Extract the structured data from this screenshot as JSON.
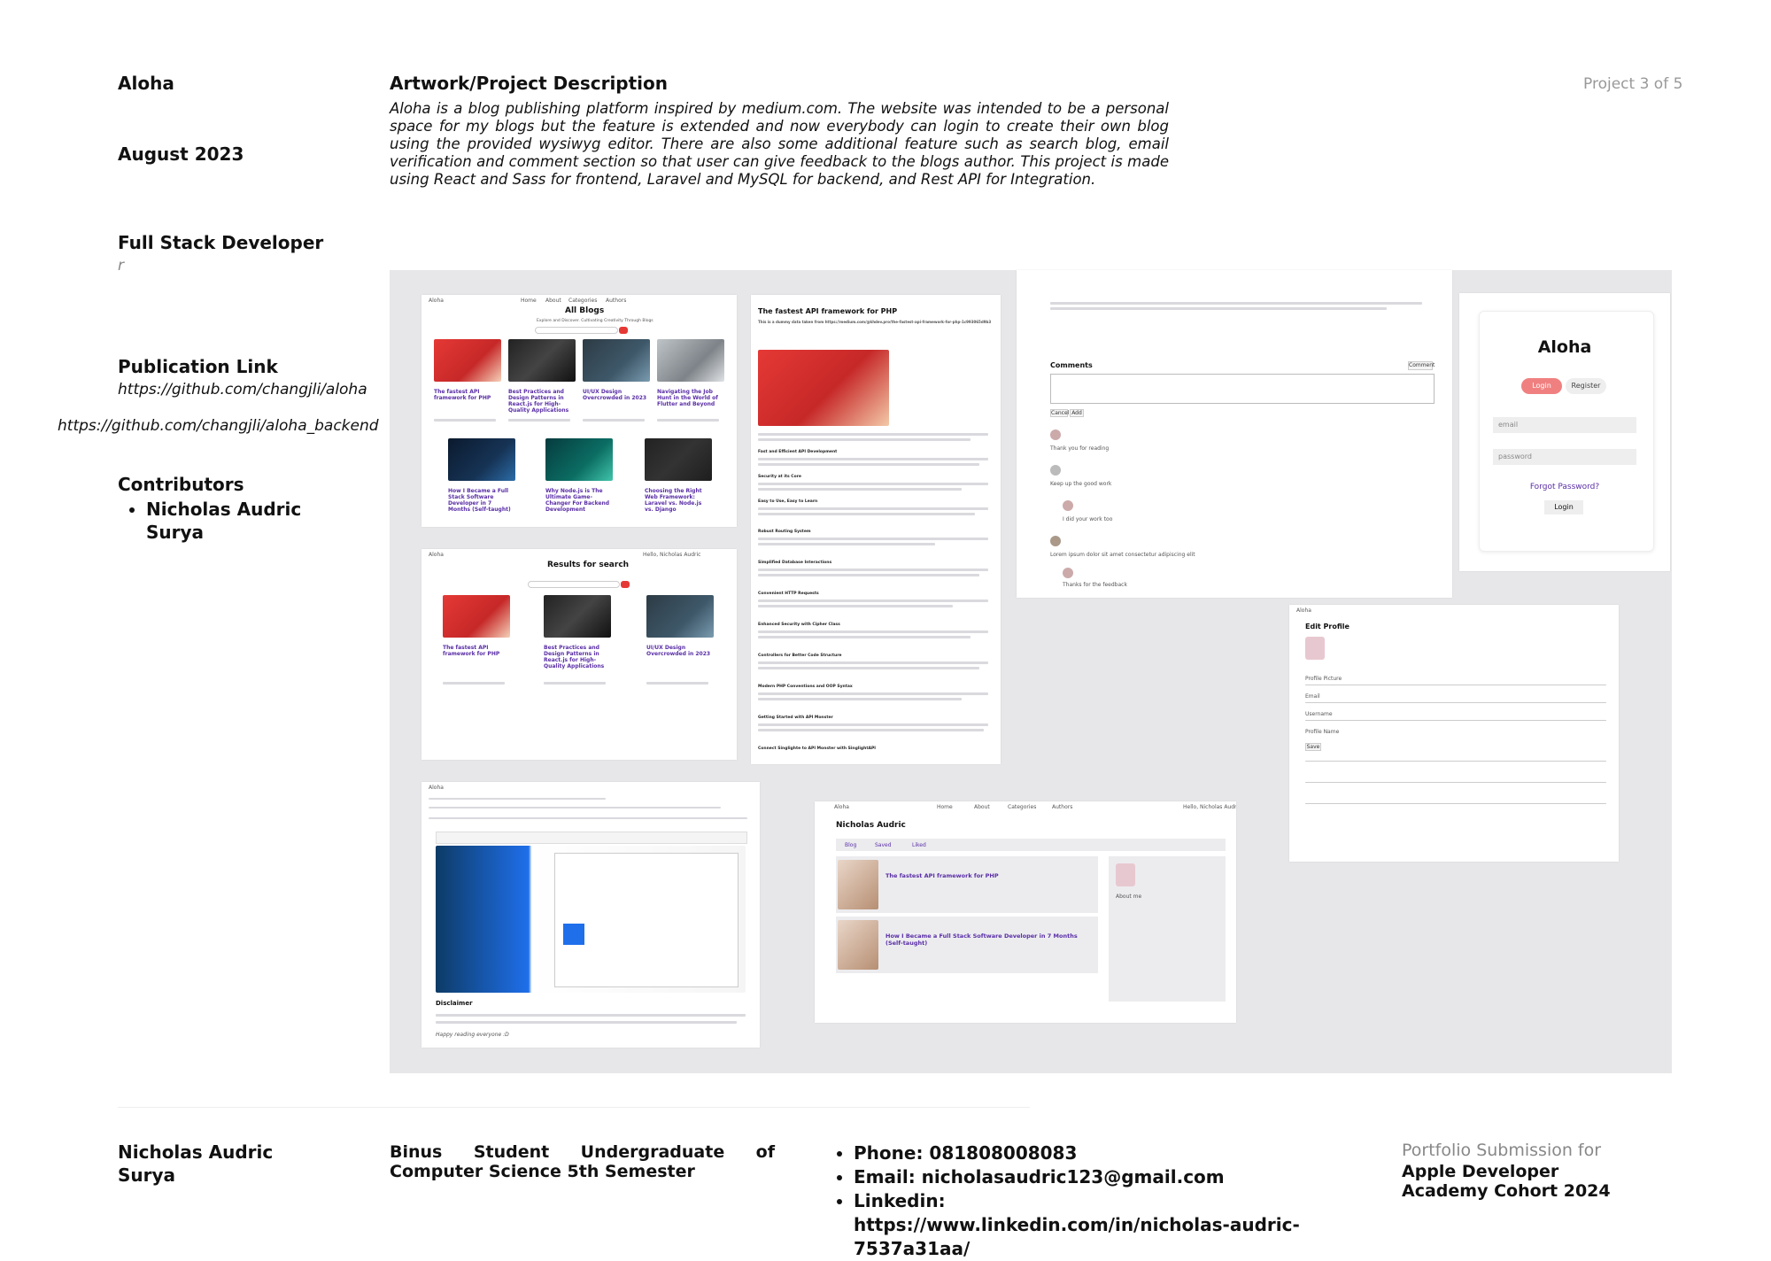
{
  "left": {
    "project_title": "Aloha",
    "date": "August 2023",
    "role": "Full Stack Developer",
    "role_sub": "r",
    "publication_heading": "Publication Link",
    "publication_links": [
      "https://github.com/changjli/aloha",
      "https://github.com/changjli/aloha_backend"
    ],
    "contributors_heading": "Contributors",
    "contributors": [
      "Nicholas Audric Surya"
    ]
  },
  "description": {
    "heading": "Artwork/Project Description",
    "text": "Aloha is a blog publishing platform inspired by medium.com. The website was intended to be a personal space for my blogs but the feature is extended and now everybody can login to create their own blog using the provided wysiwyg editor. There are also some additional feature such as search blog, email verification and comment section so that user can give feedback to the blogs author. This project is made using React and Sass for frontend, Laravel and MySQL for backend, and Rest API for Integration."
  },
  "project_counter": "Project 3 of 5",
  "screenshots": {
    "all_blogs": {
      "title": "All Blogs",
      "subtitle": "Explore and Discover. Cultivating Creativity Through Blogs",
      "cards": [
        "The fastest API framework for PHP",
        "Best Practices and Design Patterns in React.js for High-Quality Applications",
        "UI/UX Design Overcrowded in 2023",
        "Navigating the Job Hunt in the World of Flutter and Beyond",
        "How I Became a Full Stack Software Developer in 7 Months (Self-taught)",
        "Why Node.js is The Ultimate Game-Changer For Backend Development",
        "Choosing the Right Web Framework: Laravel vs. Node.js vs. Django"
      ]
    },
    "search": {
      "title": "Results for search",
      "cards": [
        "The fastest API framework for PHP",
        "Best Practices and Design Patterns in React.js for High-Quality Applications",
        "UI/UX Design Overcrowded in 2023"
      ]
    },
    "article": {
      "title": "The fastest API framework for PHP",
      "subtitle": "This is a dummy data taken from https://medium.com/@khdev.pro/the-fastest-api-framework-for-php-1c993065d9b3",
      "sections": [
        "Fast and Efficient API Development",
        "Security at its Core",
        "Easy to Use, Easy to Learn",
        "Robust Routing System",
        "Simplified Database Interactions",
        "Convenient HTTP Requests",
        "Enhanced Security with Cipher Class",
        "Controllers for Better Code Structure",
        "Modern PHP Conventions and OOP Syntax",
        "Getting Started with API Monster",
        "Connect Singlighte to API Monster with SinglightAPI"
      ]
    },
    "comments": {
      "heading": "Comments",
      "comment_button": "Comment",
      "cancel": "Cancel",
      "add": "Add",
      "entries": [
        "Thank you for reading",
        "Keep up the good work",
        "I did your work too",
        "Lorem ipsum dolor sit amet consectetur adipiscing elit",
        "Thanks for the feedback"
      ]
    },
    "login": {
      "brand": "Aloha",
      "tab_login": "Login",
      "tab_register": "Register",
      "email_placeholder": "email",
      "password_placeholder": "password",
      "forgot": "Forgot Password?",
      "submit": "Login"
    },
    "editor": {
      "disclaimer_heading": "Disclaimer",
      "closing": "Happy reading everyone :D"
    },
    "profile": {
      "name": "Nicholas Audric",
      "tabs": [
        "Blog",
        "Saved",
        "Liked"
      ],
      "posts": [
        "The fastest API framework for PHP",
        "How I Became a Full Stack Software Developer in 7 Months (Self-taught)"
      ],
      "about": "About me"
    },
    "edit_profile": {
      "title": "Edit Profile",
      "fields": [
        "Profile Picture",
        "Email",
        "Username",
        "Profile Name"
      ],
      "save": "Save"
    },
    "nav": {
      "brand": "Aloha",
      "items": [
        "Home",
        "About",
        "Categories",
        "Authors"
      ],
      "greeting": "Hello, Nicholas Audric"
    }
  },
  "footer": {
    "name": "Nicholas Audric Surya",
    "education": "Binus Student Undergraduate of Computer Science 5th Semester",
    "contacts": [
      "Phone: 081808008083",
      "Email: nicholasaudric123@gmail.com",
      "Linkedin: https://www.linkedin.com/in/nicholas-audric-7537a31aa/"
    ],
    "submission_label": "Portfolio Submission for",
    "submission_target": "Apple Developer Academy Cohort 2024"
  },
  "colors": {
    "accent": "#e53935",
    "link": "#5a2ea6",
    "panel": "#e7e7e9"
  }
}
